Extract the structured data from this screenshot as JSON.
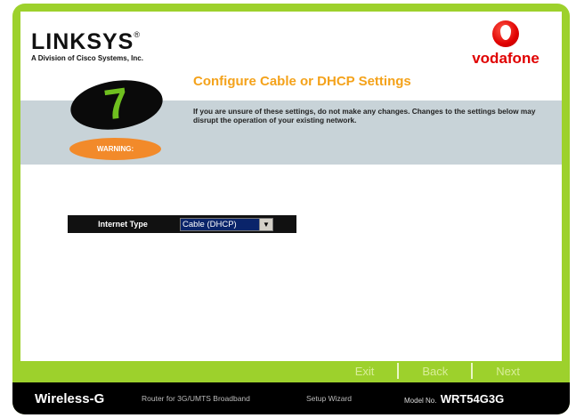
{
  "brand": {
    "name": "LINKSYS",
    "tagline": "A Division of Cisco Systems, Inc.",
    "partner": "vodafone"
  },
  "step": {
    "number": "7",
    "warning_label": "WARNING:",
    "title": "Configure Cable or DHCP Settings",
    "description": "If you are unsure of these settings, do not make any changes. Changes to the settings below may disrupt the operation of your existing network."
  },
  "form": {
    "internet_type_label": "Internet Type",
    "internet_type_value": "Cable (DHCP)"
  },
  "nav": {
    "exit": "Exit",
    "back": "Back",
    "next": "Next"
  },
  "footer": {
    "product": "Wireless-G",
    "router": "Router for 3G/UMTS Broadband",
    "wizard": "Setup Wizard",
    "model_prefix": "Model No.",
    "model": "WRT54G3G"
  },
  "colors": {
    "frame": "#9dd12c",
    "title": "#f4a21a",
    "warning": "#f28a2a",
    "step_digit": "#6fbf1f",
    "vodafone_red": "#e00000"
  }
}
